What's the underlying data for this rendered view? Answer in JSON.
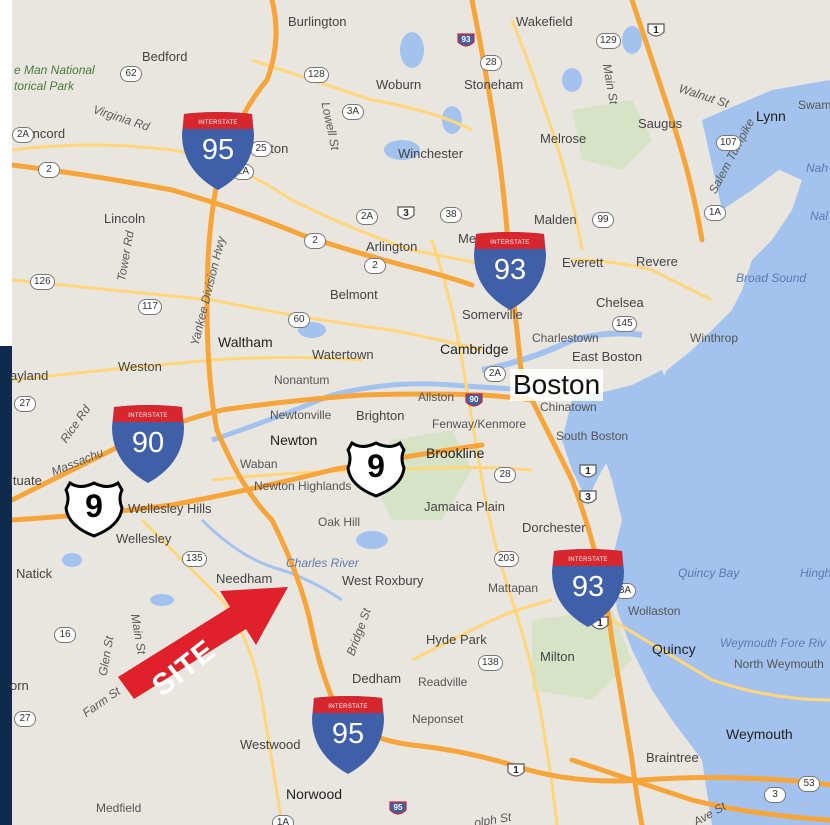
{
  "map": {
    "featured_label": "Boston",
    "site_label": "SITE",
    "colors": {
      "water": "#a3c3ee",
      "land": "#e9e6df",
      "highway": "#f6a53a",
      "arterial": "#ffd67a",
      "interstate_blue": "#3f5fa8",
      "interstate_red": "#d8262e",
      "site_red": "#e0202a",
      "sidebar": "#0f2a4d"
    }
  },
  "places": {
    "burlington": "Burlington",
    "wakefield": "Wakefield",
    "bedford": "Bedford",
    "man_national": "e Man National",
    "torical_park": "torical Park",
    "woburn": "Woburn",
    "stoneham": "Stoneham",
    "concord": "Concord",
    "lexington": "Lexington",
    "winchester": "Winchester",
    "melrose": "Melrose",
    "saugus": "Saugus",
    "lynn": "Lynn",
    "swam": "Swam",
    "nah": "Nah",
    "nal": "Nal",
    "lincoln": "Lincoln",
    "arlington": "Arlington",
    "malden": "Malden",
    "medford_partial": "Me",
    "everett": "Everett",
    "revere": "Revere",
    "broad_sound": "Broad Sound",
    "belmont": "Belmont",
    "chelsea": "Chelsea",
    "somerville": "Somerville",
    "charlestown": "Charlestown",
    "winthrop": "Winthrop",
    "waltham": "Waltham",
    "watertown": "Watertown",
    "cambridge": "Cambridge",
    "east_boston": "East Boston",
    "weston": "Weston",
    "ayland": "ayland",
    "nonantum": "Nonantum",
    "allston": "Allston",
    "chinatown": "Chinatown",
    "newtonville": "Newtonville",
    "brighton": "Brighton",
    "fenway": "Fenway/Kenmore",
    "south_boston": "South Boston",
    "newton": "Newton",
    "brookline": "Brookline",
    "waban": "Waban",
    "newton_highlands": "Newton Highlands",
    "ituate": "ituate",
    "massachu": "Massachu",
    "wellesley_hills": "Wellesley Hills",
    "oak_hill": "Oak Hill",
    "jamaica_plain": "Jamaica Plain",
    "dorchester": "Dorchester",
    "wellesley": "Wellesley",
    "natick": "Natick",
    "needham": "Needham",
    "charles_river": "Charles River",
    "west_roxbury": "West Roxbury",
    "mattapan": "Mattapan",
    "quincy_bay": "Quincy Bay",
    "hingh": "Hingh",
    "wollaston": "Wollaston",
    "hyde_park": "Hyde Park",
    "milton": "Milton",
    "quincy": "Quincy",
    "weymouth_fore": "Weymouth Fore Riv",
    "north_weymouth": "North Weymouth",
    "orn": "orn",
    "dedham": "Dedham",
    "readville": "Readville",
    "neponset": "Neponset",
    "westwood": "Westwood",
    "weymouth": "Weymouth",
    "braintree": "Braintree",
    "norwood": "Norwood",
    "medfield": "Medfield"
  },
  "roads": {
    "virginia_rd": "Virginia Rd",
    "lowell_st": "Lowell St",
    "main_st_n": "Main St",
    "walnut_st": "Walnut St",
    "salem_tpke": "Salem Turnpike",
    "tower_rd": "Tower Rd",
    "yankee_hwy": "Yankee Division Hwy",
    "rice_rd": "Rice Rd",
    "main_st_s": "Main St",
    "glen_st": "Glen St",
    "farm_st": "Farm St",
    "bridge_st": "Bridge St",
    "washington_st": "Washington St",
    "ave_st": "Ave St",
    "adolph_st": "olph St"
  },
  "routes": {
    "r62": "62",
    "r128": "128",
    "r129": "129",
    "r28n": "28",
    "r3a_n": "3A",
    "r2a_w": "2A",
    "r2w": "2",
    "r2a_lex": "2A",
    "r2a_arl": "2A",
    "r38": "38",
    "r99": "99",
    "r107": "107",
    "r1a": "1A",
    "r2_mid": "2",
    "r2_arl": "2",
    "r126": "126",
    "r117": "117",
    "r60": "60",
    "r145": "145",
    "r2a_cam": "2A",
    "r27n": "27",
    "r28s": "28",
    "r135": "135",
    "r203": "203",
    "r3a_s": "3A",
    "r16": "16",
    "r138": "138",
    "r27s": "27",
    "r53": "53",
    "r3s": "3",
    "r1a_s": "1A",
    "r25": "25"
  },
  "shields": {
    "i95_north": {
      "label": "INTERSTATE",
      "number": "95"
    },
    "i93_north": {
      "label": "INTERSTATE",
      "number": "93"
    },
    "i90": {
      "label": "INTERSTATE",
      "number": "90"
    },
    "i93_south": {
      "label": "INTERSTATE",
      "number": "93"
    },
    "i95_south": {
      "label": "INTERSTATE",
      "number": "95"
    },
    "us9_east": {
      "number": "9"
    },
    "us9_west": {
      "number": "9"
    },
    "small_93": {
      "number": "93"
    },
    "small_90": {
      "number": "90"
    },
    "small_95": {
      "number": "95"
    },
    "us1_n": {
      "number": "1"
    },
    "us1_bos": {
      "number": "1"
    },
    "us1_s": {
      "number": "1"
    },
    "us1_mid": {
      "number": "1"
    },
    "r3_n": {
      "number": "3"
    },
    "r3_bos": {
      "number": "3"
    }
  }
}
